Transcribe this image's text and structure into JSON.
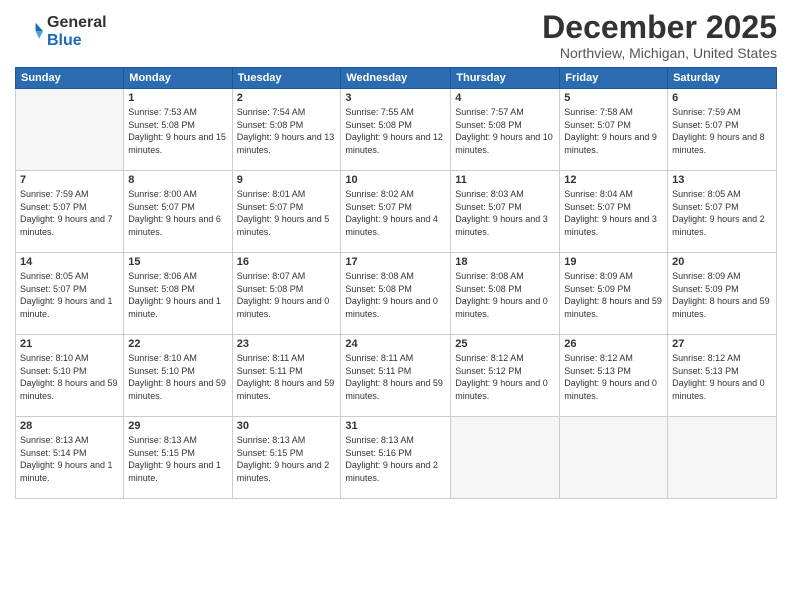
{
  "logo": {
    "general": "General",
    "blue": "Blue"
  },
  "header": {
    "month": "December 2025",
    "location": "Northview, Michigan, United States"
  },
  "days_of_week": [
    "Sunday",
    "Monday",
    "Tuesday",
    "Wednesday",
    "Thursday",
    "Friday",
    "Saturday"
  ],
  "weeks": [
    [
      {
        "day": "",
        "empty": true
      },
      {
        "day": "1",
        "sunrise": "7:53 AM",
        "sunset": "5:08 PM",
        "daylight": "9 hours and 15 minutes."
      },
      {
        "day": "2",
        "sunrise": "7:54 AM",
        "sunset": "5:08 PM",
        "daylight": "9 hours and 13 minutes."
      },
      {
        "day": "3",
        "sunrise": "7:55 AM",
        "sunset": "5:08 PM",
        "daylight": "9 hours and 12 minutes."
      },
      {
        "day": "4",
        "sunrise": "7:57 AM",
        "sunset": "5:08 PM",
        "daylight": "9 hours and 10 minutes."
      },
      {
        "day": "5",
        "sunrise": "7:58 AM",
        "sunset": "5:07 PM",
        "daylight": "9 hours and 9 minutes."
      },
      {
        "day": "6",
        "sunrise": "7:59 AM",
        "sunset": "5:07 PM",
        "daylight": "9 hours and 8 minutes."
      }
    ],
    [
      {
        "day": "7",
        "sunrise": "7:59 AM",
        "sunset": "5:07 PM",
        "daylight": "9 hours and 7 minutes."
      },
      {
        "day": "8",
        "sunrise": "8:00 AM",
        "sunset": "5:07 PM",
        "daylight": "9 hours and 6 minutes."
      },
      {
        "day": "9",
        "sunrise": "8:01 AM",
        "sunset": "5:07 PM",
        "daylight": "9 hours and 5 minutes."
      },
      {
        "day": "10",
        "sunrise": "8:02 AM",
        "sunset": "5:07 PM",
        "daylight": "9 hours and 4 minutes."
      },
      {
        "day": "11",
        "sunrise": "8:03 AM",
        "sunset": "5:07 PM",
        "daylight": "9 hours and 3 minutes."
      },
      {
        "day": "12",
        "sunrise": "8:04 AM",
        "sunset": "5:07 PM",
        "daylight": "9 hours and 3 minutes."
      },
      {
        "day": "13",
        "sunrise": "8:05 AM",
        "sunset": "5:07 PM",
        "daylight": "9 hours and 2 minutes."
      }
    ],
    [
      {
        "day": "14",
        "sunrise": "8:05 AM",
        "sunset": "5:07 PM",
        "daylight": "9 hours and 1 minute."
      },
      {
        "day": "15",
        "sunrise": "8:06 AM",
        "sunset": "5:08 PM",
        "daylight": "9 hours and 1 minute."
      },
      {
        "day": "16",
        "sunrise": "8:07 AM",
        "sunset": "5:08 PM",
        "daylight": "9 hours and 0 minutes."
      },
      {
        "day": "17",
        "sunrise": "8:08 AM",
        "sunset": "5:08 PM",
        "daylight": "9 hours and 0 minutes."
      },
      {
        "day": "18",
        "sunrise": "8:08 AM",
        "sunset": "5:08 PM",
        "daylight": "9 hours and 0 minutes."
      },
      {
        "day": "19",
        "sunrise": "8:09 AM",
        "sunset": "5:09 PM",
        "daylight": "8 hours and 59 minutes."
      },
      {
        "day": "20",
        "sunrise": "8:09 AM",
        "sunset": "5:09 PM",
        "daylight": "8 hours and 59 minutes."
      }
    ],
    [
      {
        "day": "21",
        "sunrise": "8:10 AM",
        "sunset": "5:10 PM",
        "daylight": "8 hours and 59 minutes."
      },
      {
        "day": "22",
        "sunrise": "8:10 AM",
        "sunset": "5:10 PM",
        "daylight": "8 hours and 59 minutes."
      },
      {
        "day": "23",
        "sunrise": "8:11 AM",
        "sunset": "5:11 PM",
        "daylight": "8 hours and 59 minutes."
      },
      {
        "day": "24",
        "sunrise": "8:11 AM",
        "sunset": "5:11 PM",
        "daylight": "8 hours and 59 minutes."
      },
      {
        "day": "25",
        "sunrise": "8:12 AM",
        "sunset": "5:12 PM",
        "daylight": "9 hours and 0 minutes."
      },
      {
        "day": "26",
        "sunrise": "8:12 AM",
        "sunset": "5:13 PM",
        "daylight": "9 hours and 0 minutes."
      },
      {
        "day": "27",
        "sunrise": "8:12 AM",
        "sunset": "5:13 PM",
        "daylight": "9 hours and 0 minutes."
      }
    ],
    [
      {
        "day": "28",
        "sunrise": "8:13 AM",
        "sunset": "5:14 PM",
        "daylight": "9 hours and 1 minute."
      },
      {
        "day": "29",
        "sunrise": "8:13 AM",
        "sunset": "5:15 PM",
        "daylight": "9 hours and 1 minute."
      },
      {
        "day": "30",
        "sunrise": "8:13 AM",
        "sunset": "5:15 PM",
        "daylight": "9 hours and 2 minutes."
      },
      {
        "day": "31",
        "sunrise": "8:13 AM",
        "sunset": "5:16 PM",
        "daylight": "9 hours and 2 minutes."
      },
      {
        "day": "",
        "empty": true
      },
      {
        "day": "",
        "empty": true
      },
      {
        "day": "",
        "empty": true
      }
    ]
  ]
}
